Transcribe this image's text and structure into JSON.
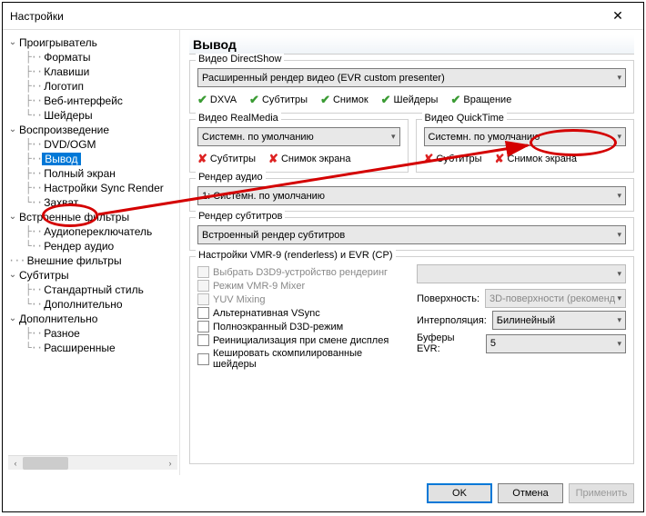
{
  "window": {
    "title": "Настройки"
  },
  "tree": {
    "n0": "Проигрыватель",
    "n0_0": "Форматы",
    "n0_1": "Клавиши",
    "n0_2": "Логотип",
    "n0_3": "Веб-интерфейс",
    "n0_4": "Шейдеры",
    "n1": "Воспроизведение",
    "n1_0": "DVD/OGM",
    "n1_1": "Вывод",
    "n1_2": "Полный экран",
    "n1_3": "Настройки Sync Render",
    "n1_4": "Захват",
    "n2": "Встроенные фильтры",
    "n2_0": "Аудиопереключатель",
    "n2_1": "Рендер аудио",
    "n3": "Внешние фильтры",
    "n4": "Субтитры",
    "n4_0": "Стандартный стиль",
    "n4_1": "Дополнительно",
    "n5": "Дополнительно",
    "n5_0": "Разное",
    "n5_1": "Расширенные"
  },
  "main": {
    "title": "Вывод",
    "ds": {
      "legend": "Видео DirectShow",
      "renderer": "Расширенный рендер видео (EVR custom presenter)",
      "f0": "DXVA",
      "f1": "Субтитры",
      "f2": "Снимок",
      "f3": "Шейдеры",
      "f4": "Вращение"
    },
    "rm": {
      "legend": "Видео RealMedia",
      "renderer": "Системн. по умолчанию",
      "f0": "Субтитры",
      "f1": "Снимок экрана"
    },
    "qt": {
      "legend": "Видео QuickTime",
      "renderer": "Системн. по умолчанию",
      "f0": "Субтитры",
      "f1": "Снимок экрана"
    },
    "audio": {
      "legend": "Рендер аудио",
      "renderer": "1: Системн. по умолчанию"
    },
    "subs": {
      "legend": "Рендер субтитров",
      "renderer": "Встроенный рендер субтитров"
    },
    "vmr": {
      "legend": "Настройки VMR-9 (renderless) и EVR (CP)",
      "c0": "Выбрать D3D9-устройство рендеринг",
      "c1": "Режим VMR-9 Mixer",
      "c2": "YUV Mixing",
      "c3": "Альтернативная VSync",
      "c4": "Полноэкранный D3D-режим",
      "c5": "Реинициализация при смене дисплея",
      "c6": "Кешировать скомпилированные шейдеры",
      "l_surface": "Поверхность:",
      "v_surface": "3D-поверхности (рекоменд",
      "l_interp": "Интерполяция:",
      "v_interp": "Билинейный",
      "l_buf": "Буферы EVR:",
      "v_buf": "5"
    }
  },
  "footer": {
    "ok": "OK",
    "cancel": "Отмена",
    "apply": "Применить"
  }
}
